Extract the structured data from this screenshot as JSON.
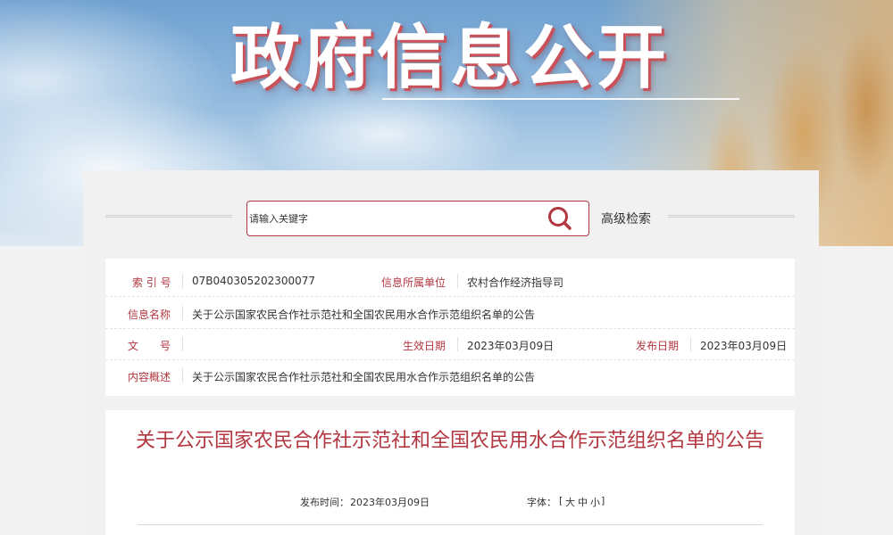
{
  "banner": {
    "title": "政府信息公开"
  },
  "search": {
    "placeholder": "请输入关键字",
    "advanced_label": "高级检索"
  },
  "info": {
    "index_label": "索 引 号",
    "index_value": "07B040305202300077",
    "org_label": "信息所属单位",
    "org_value": "农村合作经济指导司",
    "name_label": "信息名称",
    "name_value": "关于公示国家农民合作社示范社和全国农民用水合作示范组织名单的公告",
    "doc_no_label": "文　　号",
    "doc_no_value": "",
    "effective_label": "生效日期",
    "effective_value": "2023年03月09日",
    "publish_label": "发布日期",
    "publish_value": "2023年03月09日",
    "summary_label": "内容概述",
    "summary_value": "关于公示国家农民合作社示范社和全国农民用水合作示范组织名单的公告"
  },
  "article": {
    "title": "关于公示国家农民合作社示范社和全国农民用水合作示范组织名单的公告",
    "publish_time_label": "发布时间：",
    "publish_time": "2023年03月09日",
    "font_label": "字体：",
    "font_open": "[",
    "font_large": "大",
    "font_medium": "中",
    "font_small": "小",
    "font_close": "]"
  },
  "colors": {
    "accent": "#b2363f",
    "text": "#333333"
  },
  "icons": {
    "search": "search-icon"
  }
}
